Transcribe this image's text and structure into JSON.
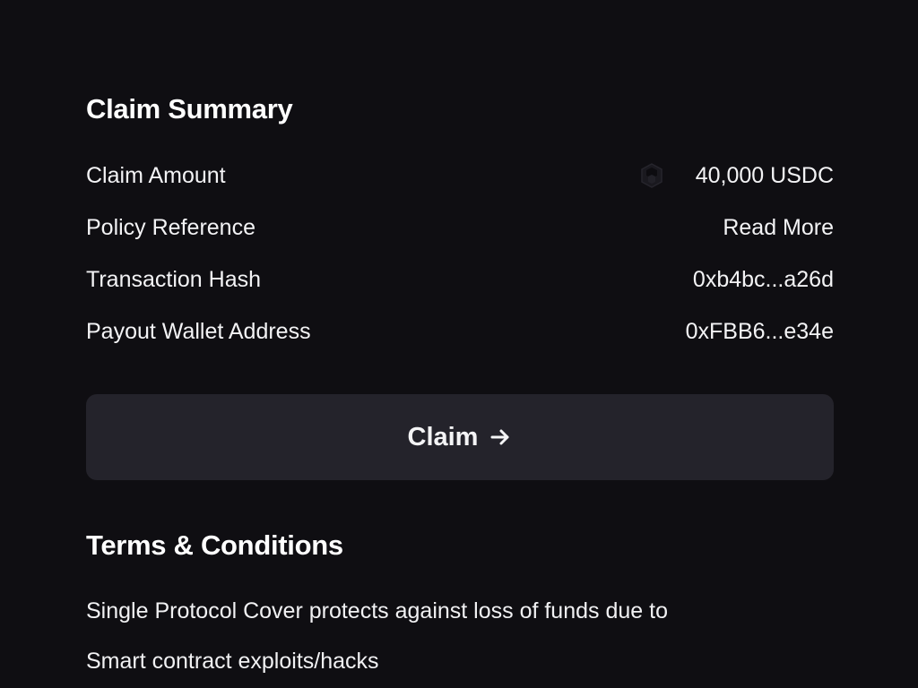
{
  "claim_summary": {
    "title": "Claim Summary",
    "rows": [
      {
        "label": "Claim Amount",
        "value": "40,000 USDC",
        "icon": "token-icon"
      },
      {
        "label": "Policy Reference",
        "value": "Read More"
      },
      {
        "label": "Transaction Hash",
        "value": "0xb4bc...a26d"
      },
      {
        "label": "Payout Wallet Address",
        "value": "0xFBB6...e34e"
      }
    ]
  },
  "claim_button": {
    "label": "Claim",
    "icon": "arrow-right-icon"
  },
  "terms": {
    "title": "Terms & Conditions",
    "lines": [
      "Single Protocol Cover protects against loss of funds due to",
      "Smart contract exploits/hacks"
    ]
  },
  "colors": {
    "background": "#0f0e12",
    "button_background": "#24232b",
    "text": "#ffffff"
  }
}
